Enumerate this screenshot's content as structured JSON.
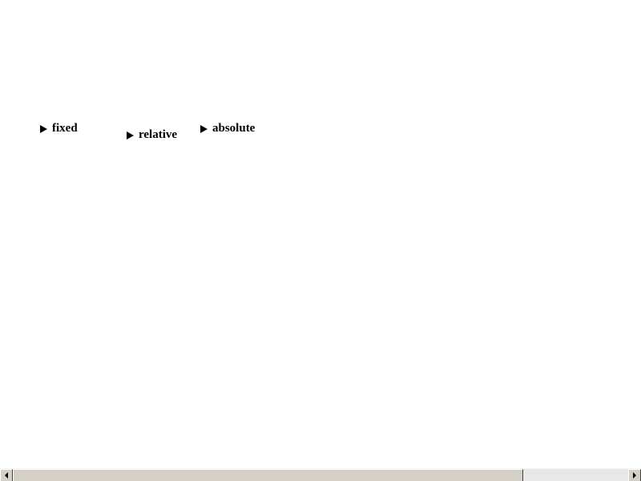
{
  "details": [
    {
      "label": "fixed",
      "expanded": false
    },
    {
      "label": "relative",
      "expanded": false
    },
    {
      "label": "absolute",
      "expanded": false
    }
  ],
  "scrollbar": {
    "orientation": "horizontal",
    "thumb_fraction": 0.83,
    "scroll_position": 0
  },
  "colors": {
    "background": "#ffffff",
    "text": "#000000",
    "scrollbar_face": "#d4d0c8",
    "scrollbar_track": "#e8e8e8"
  }
}
